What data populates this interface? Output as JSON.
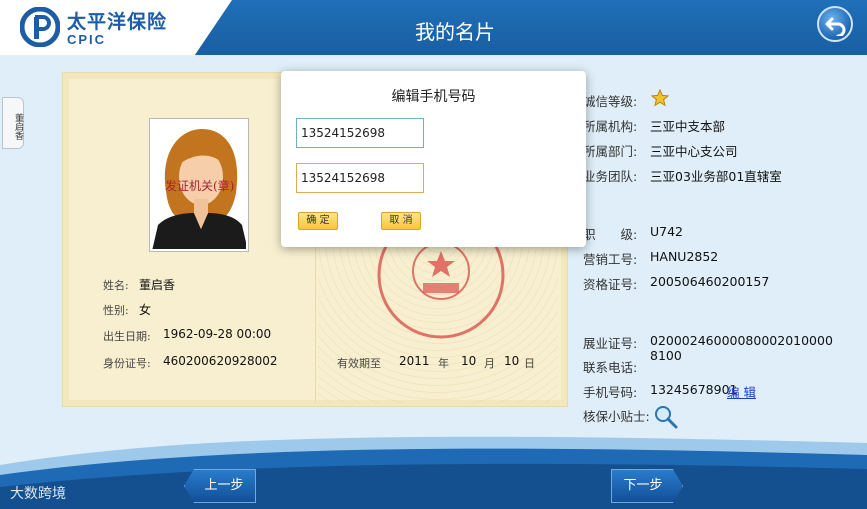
{
  "header": {
    "logo_cn": "太平洋保险",
    "logo_en": "CPIC",
    "title": "我的名片"
  },
  "side_tab": {
    "label": "董启香"
  },
  "card": {
    "name_label": "姓名:",
    "name_value": "董启香",
    "gender_label": "性别:",
    "gender_value": "女",
    "birth_label": "出生日期:",
    "birth_value": "1962-09-28 00:00",
    "id_label": "身份证号:",
    "id_value": "460200620928002",
    "valid_label": "有效期至",
    "valid_year": "2011",
    "year_unit": "年",
    "valid_month": "10",
    "month_unit": "月",
    "valid_day": "10",
    "day_unit": "日",
    "seal_text": "发证机关(章)"
  },
  "info": {
    "credit_label": "诚信等级:",
    "org_label": "所属机构:",
    "org_value": "三亚中支本部",
    "dept_label": "所属部门:",
    "dept_value": "三亚中心支公司",
    "team_label": "业务团队:",
    "team_value": "三亚03业务部01直辖室",
    "rank_label": "职　　级:",
    "rank_value": "U742",
    "sales_label": "营销工号:",
    "sales_value": "HANU2852",
    "cert_label": "资格证号:",
    "cert_value": "200506460200157",
    "practice_label": "展业证号:",
    "practice_value": "02000246000080002010000 8100",
    "phone_label": "联系电话:",
    "phone_value": "",
    "mobile_label": "手机号码:",
    "mobile_value": "13245678901",
    "edit_label": "编 辑",
    "tips_label": "核保小贴士:"
  },
  "dialog": {
    "title": "编辑手机号码",
    "input1_value": "13524152698",
    "input2_value": "13524152698",
    "ok_label": "确 定",
    "cancel_label": "取 消"
  },
  "footer": {
    "prev_label": "上一步",
    "next_label": "下一步",
    "watermark": "大数跨境"
  },
  "colors": {
    "brand_blue": "#1a5ea2",
    "card_bg": "#f7efcf",
    "button_yellow": "#f5c63a"
  },
  "icons": [
    "cpic-logo-icon",
    "back-arrow-icon",
    "star-icon",
    "magnifier-icon"
  ]
}
